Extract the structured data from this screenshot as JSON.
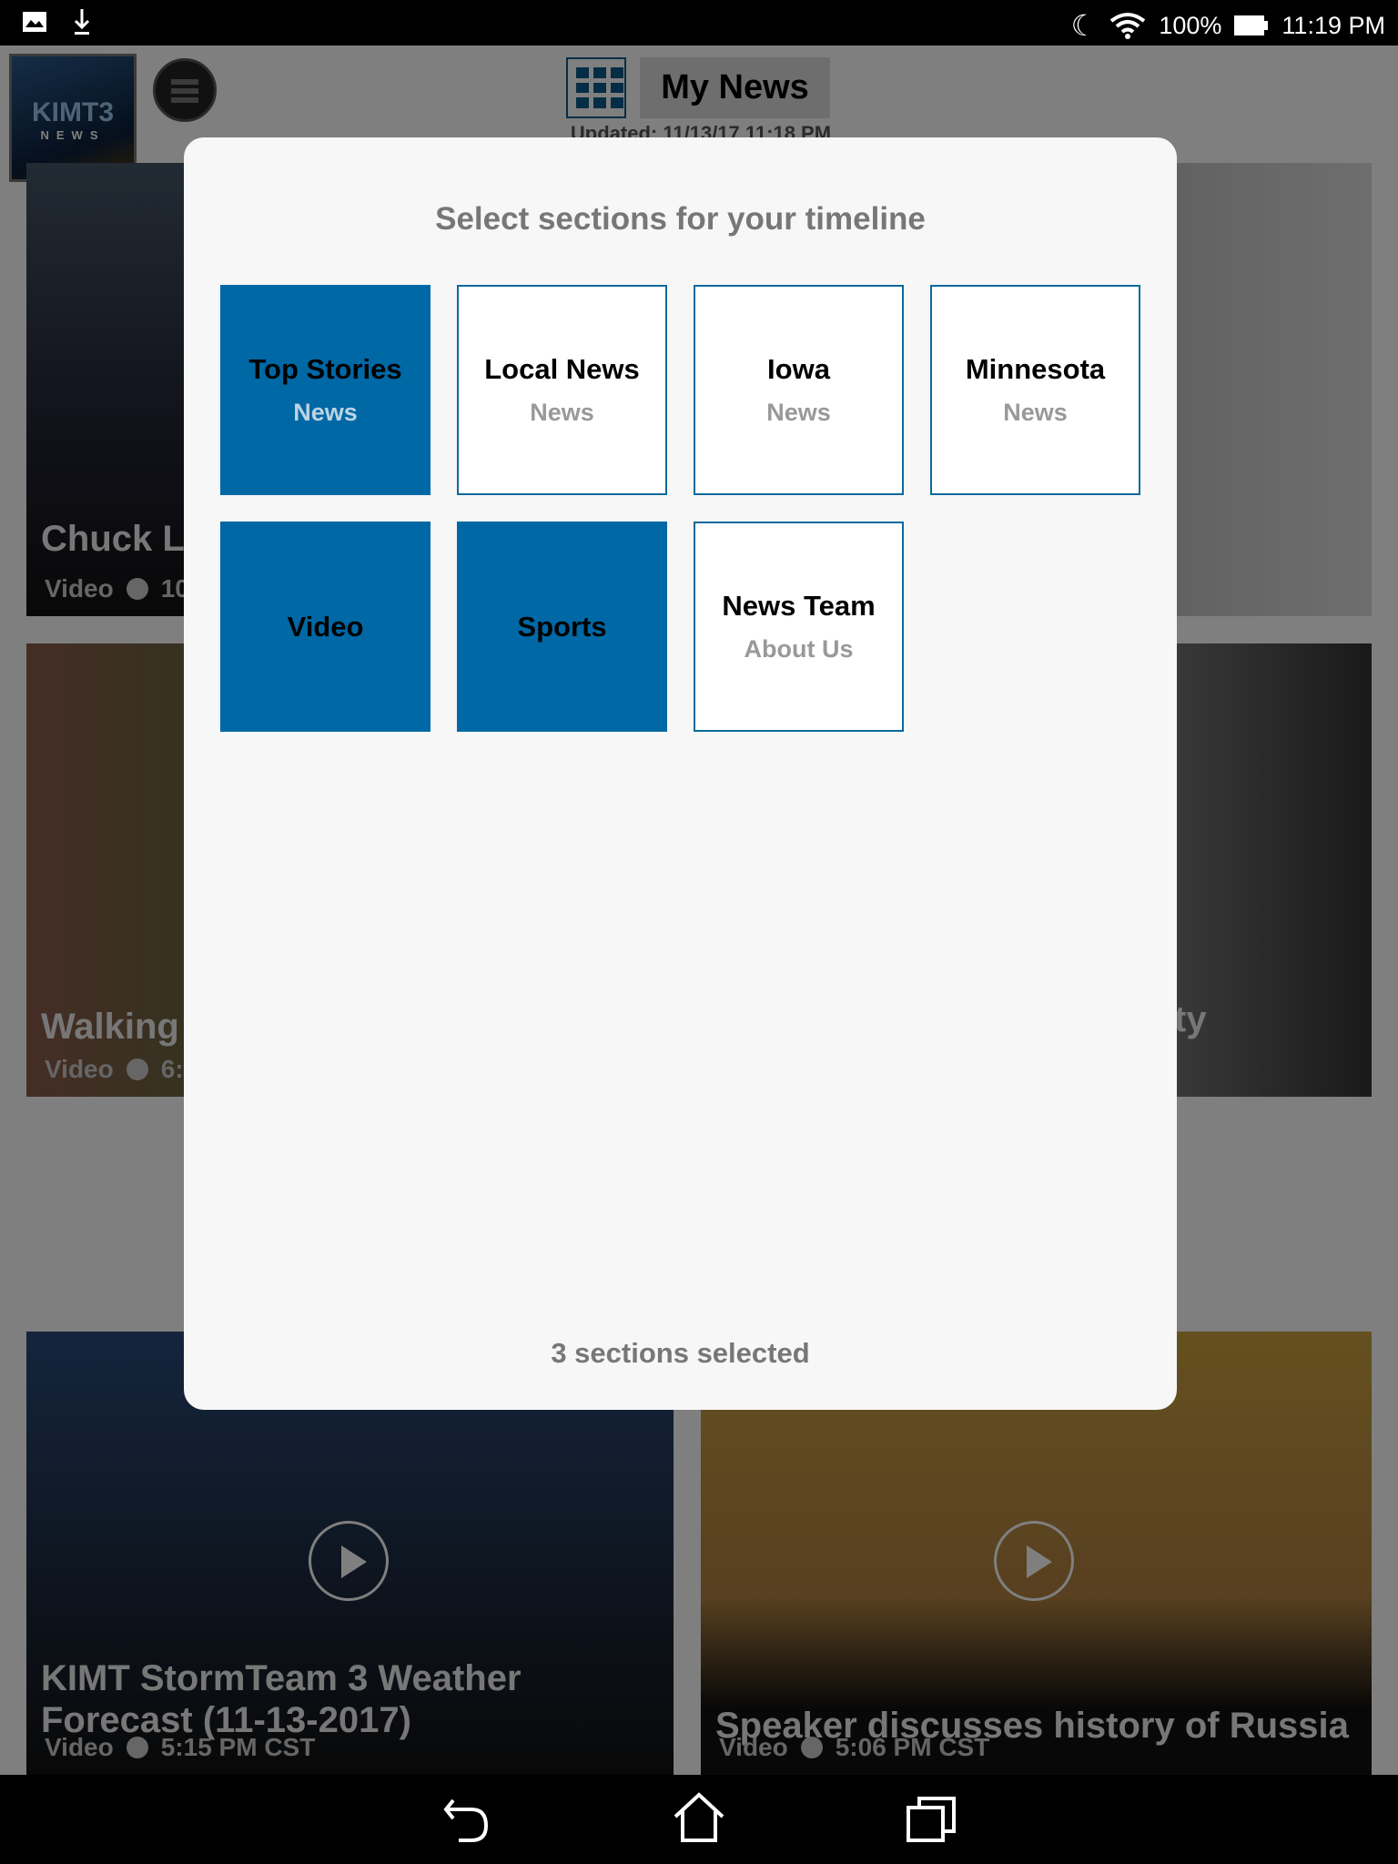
{
  "status_bar": {
    "icons": [
      "image-icon",
      "download-icon",
      "moon-icon",
      "wifi-icon"
    ],
    "battery": "100%",
    "time": "11:19 PM"
  },
  "header": {
    "logo": "KIMT3 NEWS",
    "title": "My News",
    "updated": "Updated: 11/13/17 11:18 PM"
  },
  "cards": [
    {
      "title": "Chuck Lo",
      "type": "Video",
      "time": "10"
    },
    {
      "title": "",
      "type": "",
      "time": ""
    },
    {
      "title": "Walking ",
      "type": "Video",
      "time": "6:"
    },
    {
      "title": "ty",
      "type": "",
      "time": ""
    },
    {
      "title": "KIMT StormTeam 3 Weather Forecast (11-13-2017)",
      "type": "Video",
      "time": "5:15 PM CST"
    },
    {
      "title": "Speaker discusses history of Russia",
      "type": "Video",
      "time": "5:06 PM CST"
    }
  ],
  "dialog": {
    "title": "Select sections for your timeline",
    "sections": [
      {
        "name": "Top Stories",
        "sub": "News",
        "selected": true
      },
      {
        "name": "Local News",
        "sub": "News",
        "selected": false
      },
      {
        "name": "Iowa",
        "sub": "News",
        "selected": false
      },
      {
        "name": "Minnesota",
        "sub": "News",
        "selected": false
      },
      {
        "name": "Video",
        "sub": "",
        "selected": true
      },
      {
        "name": "Sports",
        "sub": "",
        "selected": true
      },
      {
        "name": "News Team",
        "sub": "About Us",
        "selected": false
      }
    ],
    "count_text": "3 sections selected"
  },
  "colors": {
    "accent": "#0068a5"
  },
  "nav": {
    "icons": [
      "back-icon",
      "home-icon",
      "recents-icon"
    ]
  }
}
